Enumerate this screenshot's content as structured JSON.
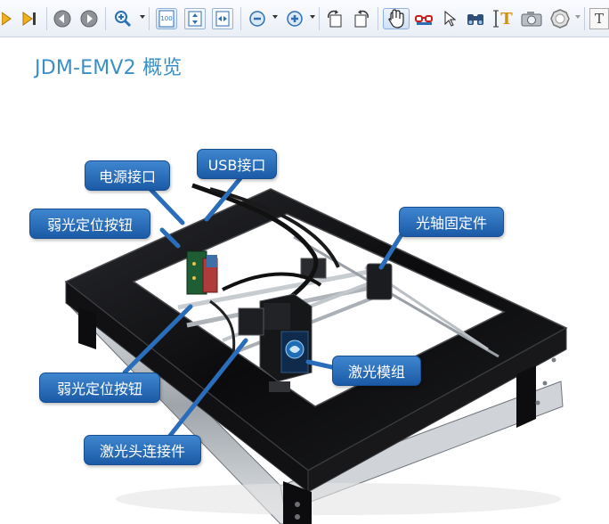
{
  "toolbar": {
    "buttons": [
      {
        "name": "play-icon"
      },
      {
        "name": "last-page-icon"
      },
      {
        "name": "back-icon"
      },
      {
        "name": "forward-icon"
      },
      {
        "name": "zoom-in-icon"
      },
      {
        "name": "actual-size-icon"
      },
      {
        "name": "fit-page-icon"
      },
      {
        "name": "fit-width-icon"
      },
      {
        "name": "zoom-out-icon"
      },
      {
        "name": "zoom-in-plus-icon"
      },
      {
        "name": "rotate-left-icon"
      },
      {
        "name": "rotate-right-icon"
      },
      {
        "name": "hand-tool-icon"
      },
      {
        "name": "glasses-icon"
      },
      {
        "name": "select-arrow-icon"
      },
      {
        "name": "binoculars-icon"
      },
      {
        "name": "text-select-icon"
      },
      {
        "name": "snapshot-icon"
      },
      {
        "name": "stamp-icon"
      },
      {
        "name": "typewriter-icon"
      }
    ],
    "actual_size_label": "100",
    "text_tool_label": "T",
    "typewriter_label": "T"
  },
  "page": {
    "title": "JDM-EMV2 概览"
  },
  "callouts": {
    "power_port": "电源接口",
    "usb_port": "USB接口",
    "weak_light_button_top": "弱光定位按钮",
    "axis_fixing": "光轴固定件",
    "laser_module": "激光模组",
    "weak_light_button_bottom": "弱光定位按钮",
    "laser_head_connector": "激光头连接件"
  },
  "colors": {
    "title": "#3a8fc6",
    "callout_bg": "#2a6dbb",
    "callout_text": "#ffffff",
    "frame": "#0d0d10"
  }
}
